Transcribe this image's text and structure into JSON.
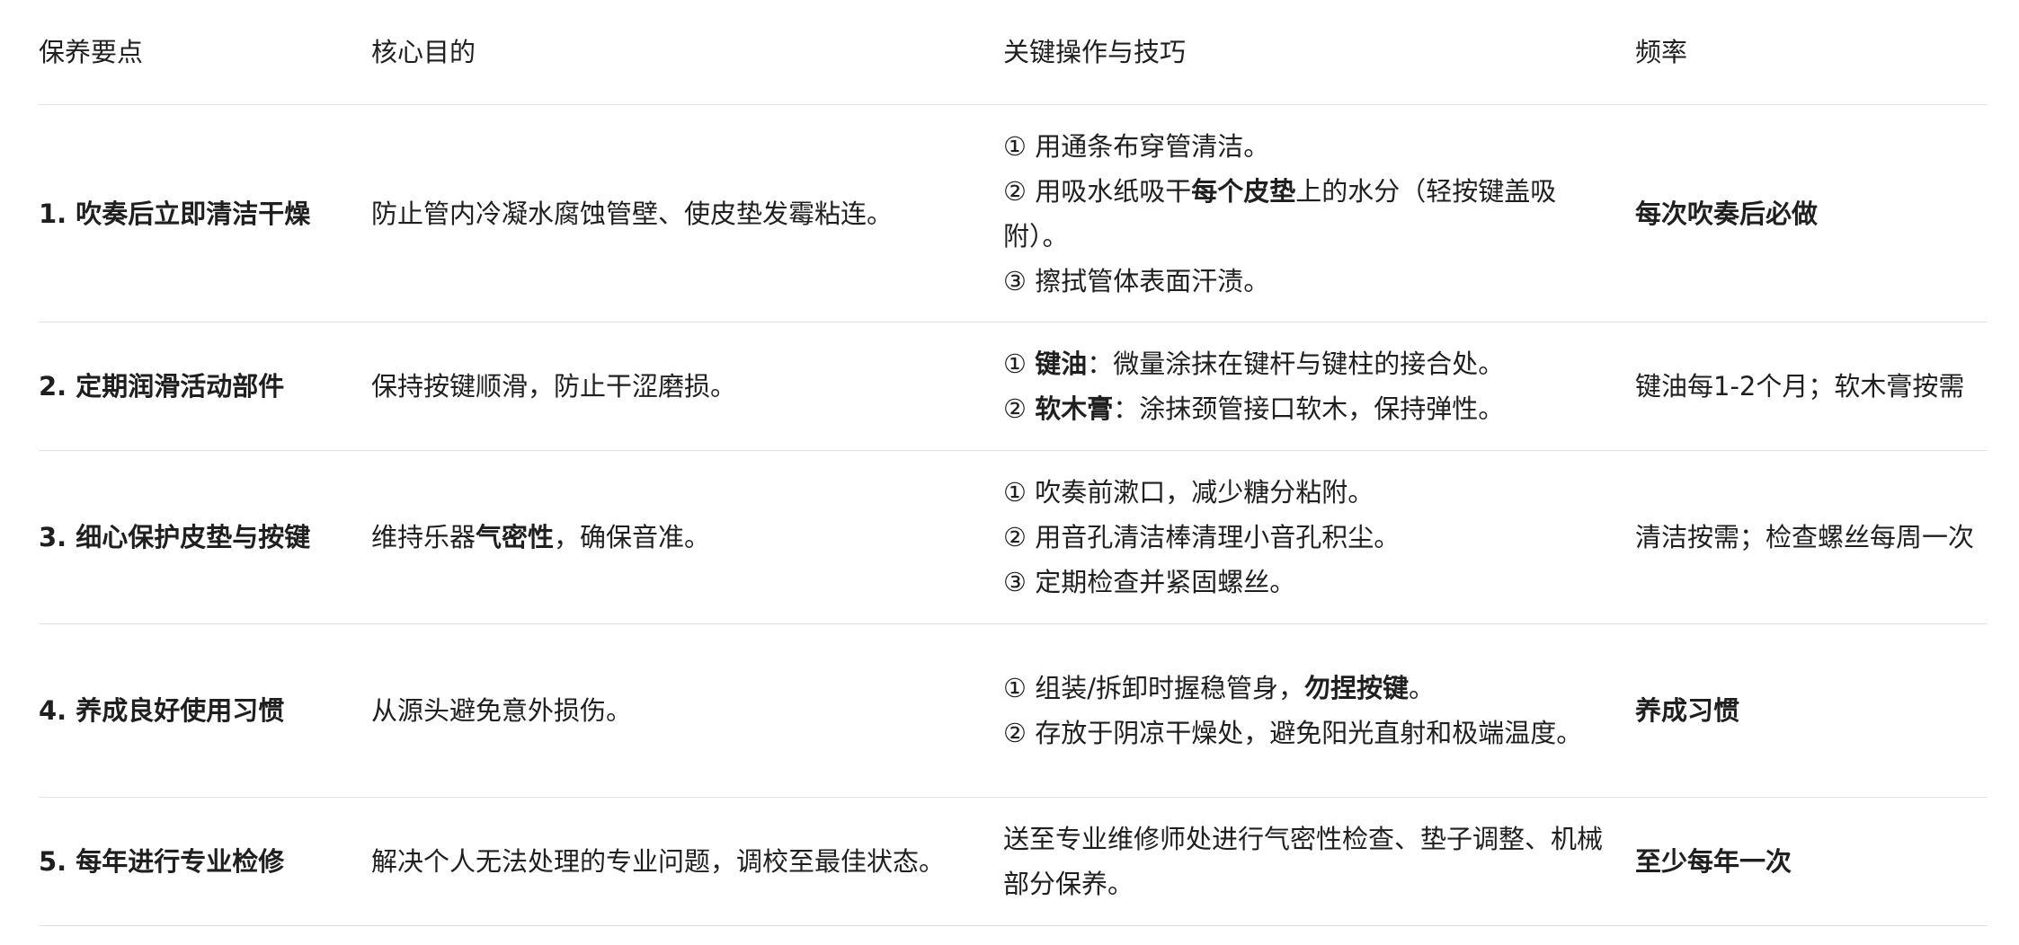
{
  "headers": [
    "保养要点",
    "核心目的",
    "关键操作与技巧",
    "频率"
  ],
  "rows": [
    {
      "point": "1. 吹奏后立即清洁干燥",
      "purpose_parts": [
        "防止管内冷凝水腐蚀管壁、使皮垫发霉粘连。"
      ],
      "ops": {
        "l1": "① 用通条布穿管清洁。",
        "l2a": "② 用吸水纸吸干",
        "l2b": "每个皮垫",
        "l2c": "上的水分（轻按键盖吸附）。",
        "l3": "③ 擦拭管体表面汗渍。"
      },
      "freq": "每次吹奏后必做"
    },
    {
      "point": "2. 定期润滑活动部件",
      "purpose": "保持按键顺滑，防止干涩磨损。",
      "ops": {
        "l1a": "① ",
        "l1b": "键油",
        "l1c": "：微量涂抹在键杆与键柱的接合处。",
        "l2a": "② ",
        "l2b": "软木膏",
        "l2c": "：涂抹颈管接口软木，保持弹性。"
      },
      "freq": "键油每1-2个月；软木膏按需"
    },
    {
      "point": "3. 细心保护皮垫与按键",
      "purpose": {
        "a": "维持乐器",
        "b": "气密性",
        "c": "，确保音准。"
      },
      "ops": {
        "l1": "① 吹奏前漱口，减少糖分粘附。",
        "l2": "② 用音孔清洁棒清理小音孔积尘。",
        "l3": "③ 定期检查并紧固螺丝。"
      },
      "freq": "清洁按需；检查螺丝每周一次"
    },
    {
      "point": "4. 养成良好使用习惯",
      "purpose": "从源头避免意外损伤。",
      "ops": {
        "l1a": "① 组装/拆卸时握稳管身，",
        "l1b": "勿捏按键",
        "l1c": "。",
        "l2": "② 存放于阴凉干燥处，避免阳光直射和极端温度。"
      },
      "freq": "养成习惯"
    },
    {
      "point": "5. 每年进行专业检修",
      "purpose": "解决个人无法处理的专业问题，调校至最佳状态。",
      "ops": "送至专业维修师处进行气密性检查、垫子调整、机械部分保养。",
      "freq": "至少每年一次"
    }
  ]
}
